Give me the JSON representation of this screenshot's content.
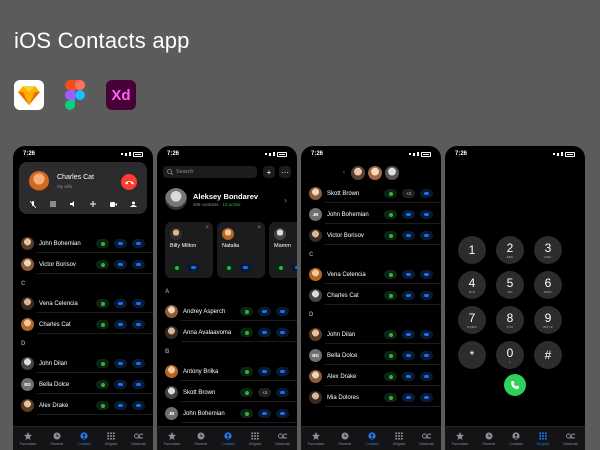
{
  "title": "iOS Contacts app",
  "tools": [
    "Sketch",
    "Figma",
    "Xd"
  ],
  "colors": {
    "background": "#5b5b5b",
    "accent": "#1a7cf5",
    "green": "#30d158",
    "red": "#ff3b30"
  },
  "status_time": "7:26",
  "tabs": [
    "Favourites",
    "Recents",
    "Contacts",
    "Keypad",
    "Voicemail"
  ],
  "phone1": {
    "call": {
      "name": "Charles Cat",
      "sub": "My wife"
    },
    "rows": [
      {
        "name": "John Bohemian",
        "initials": ""
      },
      {
        "name": "Victor Borisov",
        "initials": ""
      },
      {
        "section": "C"
      },
      {
        "name": "Vena Celencia",
        "initials": ""
      },
      {
        "name": "Charles Cat",
        "initials": ""
      },
      {
        "section": "D"
      },
      {
        "name": "John Dilan",
        "initials": ""
      },
      {
        "name": "Bella Dolce",
        "initials": "BD"
      },
      {
        "name": "Alex Drake",
        "initials": ""
      }
    ]
  },
  "phone2": {
    "search_placeholder": "Search",
    "profile": {
      "name": "Aleksey Bondarev",
      "contacts": "406 contacts",
      "online": "13 active"
    },
    "favourites": [
      {
        "name": "Billy Milton"
      },
      {
        "name": "Natalia"
      },
      {
        "name": "Mamm"
      }
    ],
    "rows": [
      {
        "section": "A"
      },
      {
        "name": "Andrey Asperch",
        "initials": ""
      },
      {
        "name": "Anna Avalaavoma",
        "initials": ""
      },
      {
        "section": "B"
      },
      {
        "name": "Antony Brilka",
        "initials": ""
      },
      {
        "name": "Skott Brown",
        "initials": "",
        "more": "+3"
      },
      {
        "name": "John Bohemian",
        "initials": "JB"
      },
      {
        "name": "Victor Borisov",
        "initials": ""
      }
    ]
  },
  "phone3": {
    "header_count": "+3",
    "rows": [
      {
        "name": "Skott Brown",
        "initials": "",
        "more": "+3"
      },
      {
        "name": "John Bohemian",
        "initials": "JB"
      },
      {
        "name": "Victor Borisov",
        "initials": ""
      },
      {
        "section": "C"
      },
      {
        "name": "Vena Celencia",
        "initials": ""
      },
      {
        "name": "Charles Cat",
        "initials": ""
      },
      {
        "section": "D"
      },
      {
        "name": "John Dilan",
        "initials": ""
      },
      {
        "name": "Bella Dolce",
        "initials": "BD"
      },
      {
        "name": "Alex Drake",
        "initials": ""
      },
      {
        "name": "Mia Dolores",
        "initials": ""
      }
    ]
  },
  "keypad": [
    {
      "d": "1",
      "l": ""
    },
    {
      "d": "2",
      "l": "ABC"
    },
    {
      "d": "3",
      "l": "DEF"
    },
    {
      "d": "4",
      "l": "GHI"
    },
    {
      "d": "5",
      "l": "JKL"
    },
    {
      "d": "6",
      "l": "MNO"
    },
    {
      "d": "7",
      "l": "PQRS"
    },
    {
      "d": "8",
      "l": "TUV"
    },
    {
      "d": "9",
      "l": "WXYZ"
    },
    {
      "d": "*",
      "l": ""
    },
    {
      "d": "0",
      "l": "+"
    },
    {
      "d": "#",
      "l": ""
    }
  ]
}
